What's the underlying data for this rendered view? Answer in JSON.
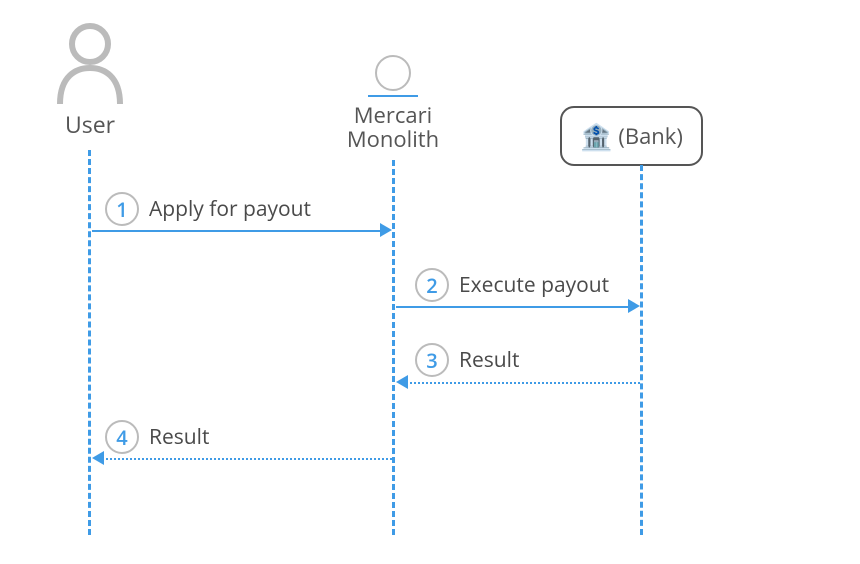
{
  "actors": {
    "user": "User",
    "monolith_line1": "Mercari",
    "monolith_line2": "Monolith",
    "bank": "(Bank)",
    "bank_icon": "🏦"
  },
  "steps": {
    "s1": {
      "n": "1",
      "label": "Apply for payout"
    },
    "s2": {
      "n": "2",
      "label": "Execute payout"
    },
    "s3": {
      "n": "3",
      "label": "Result"
    },
    "s4": {
      "n": "4",
      "label": "Result"
    }
  }
}
